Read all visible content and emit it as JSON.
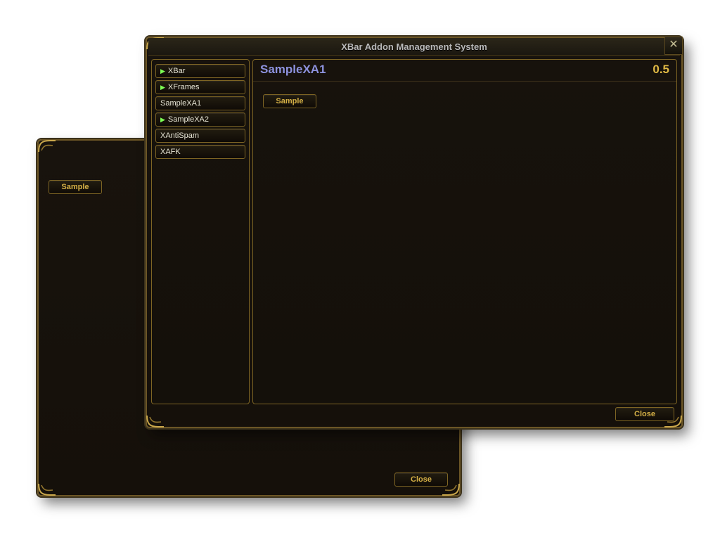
{
  "window_back": {
    "buttons": {
      "sample": "Sample",
      "close": "Close"
    }
  },
  "window_main": {
    "title": "XBar Addon Management System",
    "sidebar": {
      "items": [
        {
          "label": "XBar",
          "active": true
        },
        {
          "label": "XFrames",
          "active": true
        },
        {
          "label": "SampleXA1",
          "active": false,
          "selected": true
        },
        {
          "label": "SampleXA2",
          "active": true
        },
        {
          "label": "XAntiSpam",
          "active": false
        },
        {
          "label": "XAFK",
          "active": false
        }
      ]
    },
    "content": {
      "title": "SampleXA1",
      "version": "0.5",
      "buttons": {
        "sample": "Sample"
      }
    },
    "footer": {
      "close": "Close"
    }
  }
}
